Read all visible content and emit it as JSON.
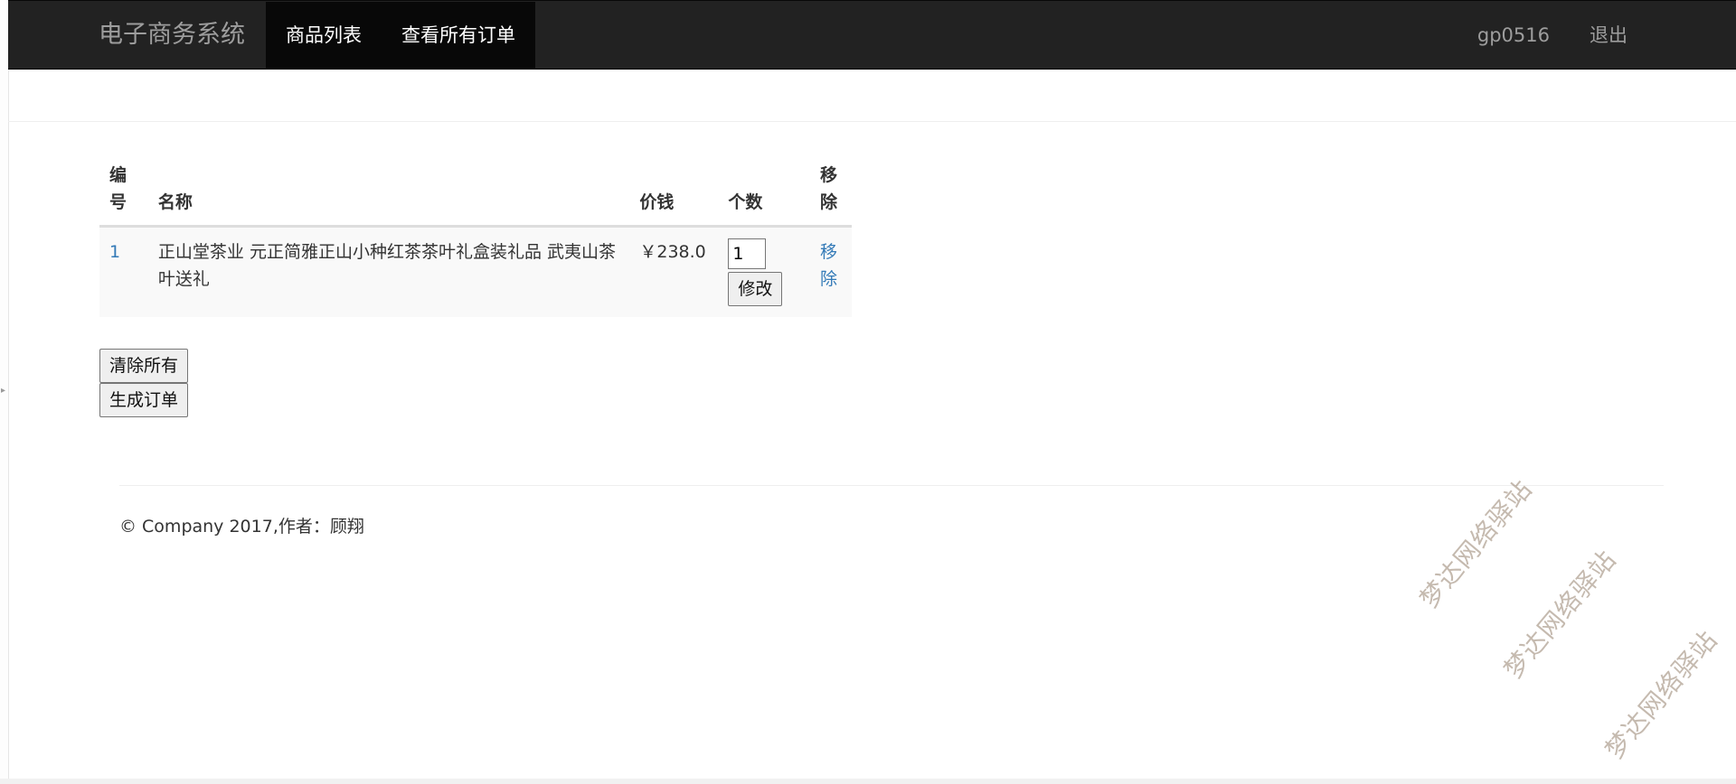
{
  "navbar": {
    "brand": "电子商务系统",
    "links": [
      "商品列表",
      "查看所有订单"
    ],
    "user": "gp0516",
    "logout": "退出"
  },
  "cart": {
    "headers": {
      "id": "编号",
      "name": "名称",
      "price": "价钱",
      "qty": "个数",
      "remove": "移除"
    },
    "rows": [
      {
        "id": "1",
        "name": "正山堂茶业 元正简雅正山小种红茶茶叶礼盒装礼品 武夷山茶叶送礼",
        "price": "￥238.0",
        "qty": "1",
        "modify": "修改",
        "remove": "移除"
      }
    ],
    "clear_all": "清除所有",
    "create_order": "生成订单"
  },
  "footer": {
    "text": "© Company 2017,作者：顾翔"
  },
  "watermark": {
    "text": "梦达网络驿站"
  },
  "colors": {
    "navbar_bg": "#222222",
    "active_nav_bg": "#080808",
    "link": "#337ab7",
    "row_bg": "#f9f9f9"
  }
}
